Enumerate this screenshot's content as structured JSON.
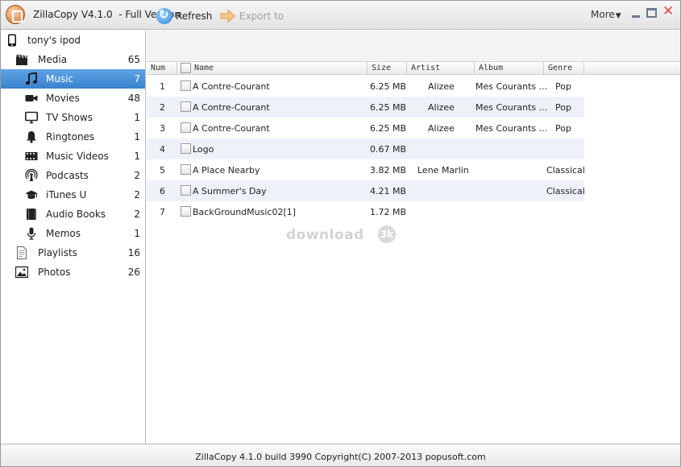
{
  "app": {
    "title": "ZillaCopy V4.1.0  - Full Version",
    "more_label": "More",
    "arrow_glyph": "▼",
    "close_glyph": "✕"
  },
  "sidebar": {
    "device": {
      "label": "tony's ipod",
      "icon": "ipod-icon"
    },
    "media": {
      "label": "Media",
      "count": "65",
      "icon": "clapperboard-icon"
    },
    "media_items": [
      {
        "label": "Music",
        "count": "7",
        "icon": "music-note-icon",
        "selected": true
      },
      {
        "label": "Movies",
        "count": "48",
        "icon": "video-camera-icon"
      },
      {
        "label": "TV Shows",
        "count": "1",
        "icon": "tv-icon"
      },
      {
        "label": "Ringtones",
        "count": "1",
        "icon": "bell-icon"
      },
      {
        "label": "Music Videos",
        "count": "1",
        "icon": "film-icon"
      },
      {
        "label": "Podcasts",
        "count": "2",
        "icon": "podcast-icon"
      },
      {
        "label": "iTunes U",
        "count": "2",
        "icon": "graduation-cap-icon"
      },
      {
        "label": "Audio Books",
        "count": "2",
        "icon": "book-icon"
      },
      {
        "label": "Memos",
        "count": "1",
        "icon": "microphone-icon"
      }
    ],
    "playlists": {
      "label": "Playlists",
      "count": "16",
      "icon": "document-icon"
    },
    "photos": {
      "label": "Photos",
      "count": "26",
      "icon": "picture-icon"
    }
  },
  "toolbar": {
    "refresh_label": "Refresh",
    "export_label": "Export to",
    "refresh_icon": "refresh-icon",
    "export_icon": "export-arrow-icon"
  },
  "table": {
    "columns": {
      "num": "Num",
      "name": "Name",
      "size": "Size",
      "artist": "Artist",
      "album": "Album",
      "genre": "Genre"
    },
    "rows": [
      {
        "num": "1",
        "name": "A Contre-Courant",
        "size": "6.25 MB",
        "artist": "Alizee",
        "album": "Mes Courants ...",
        "genre": "Pop"
      },
      {
        "num": "2",
        "name": "A Contre-Courant",
        "size": "6.25 MB",
        "artist": "Alizee",
        "album": "Mes Courants ...",
        "genre": "Pop"
      },
      {
        "num": "3",
        "name": "A Contre-Courant",
        "size": "6.25 MB",
        "artist": "Alizee",
        "album": "Mes Courants ...",
        "genre": "Pop"
      },
      {
        "num": "4",
        "name": "Logo",
        "size": "0.67 MB",
        "artist": "",
        "album": "",
        "genre": ""
      },
      {
        "num": "5",
        "name": "A Place Nearby",
        "size": "3.82 MB",
        "artist": "Lene Marlin",
        "album": "",
        "genre": "Classical"
      },
      {
        "num": "6",
        "name": "A Summer's Day",
        "size": "4.21 MB",
        "artist": "",
        "album": "",
        "genre": "Classical"
      },
      {
        "num": "7",
        "name": "BackGroundMusic02[1]",
        "size": "1.72 MB",
        "artist": "",
        "album": "",
        "genre": ""
      }
    ]
  },
  "watermark": {
    "text": "download",
    "badge": "3k"
  },
  "statusbar": {
    "text": "ZillaCopy 4.1.0 build 3990 Copyright(C) 2007-2013 popusoft.com"
  },
  "colors": {
    "selection": "#3a82cf",
    "row_alt": "#eef2f8",
    "close": "#e0463c"
  }
}
